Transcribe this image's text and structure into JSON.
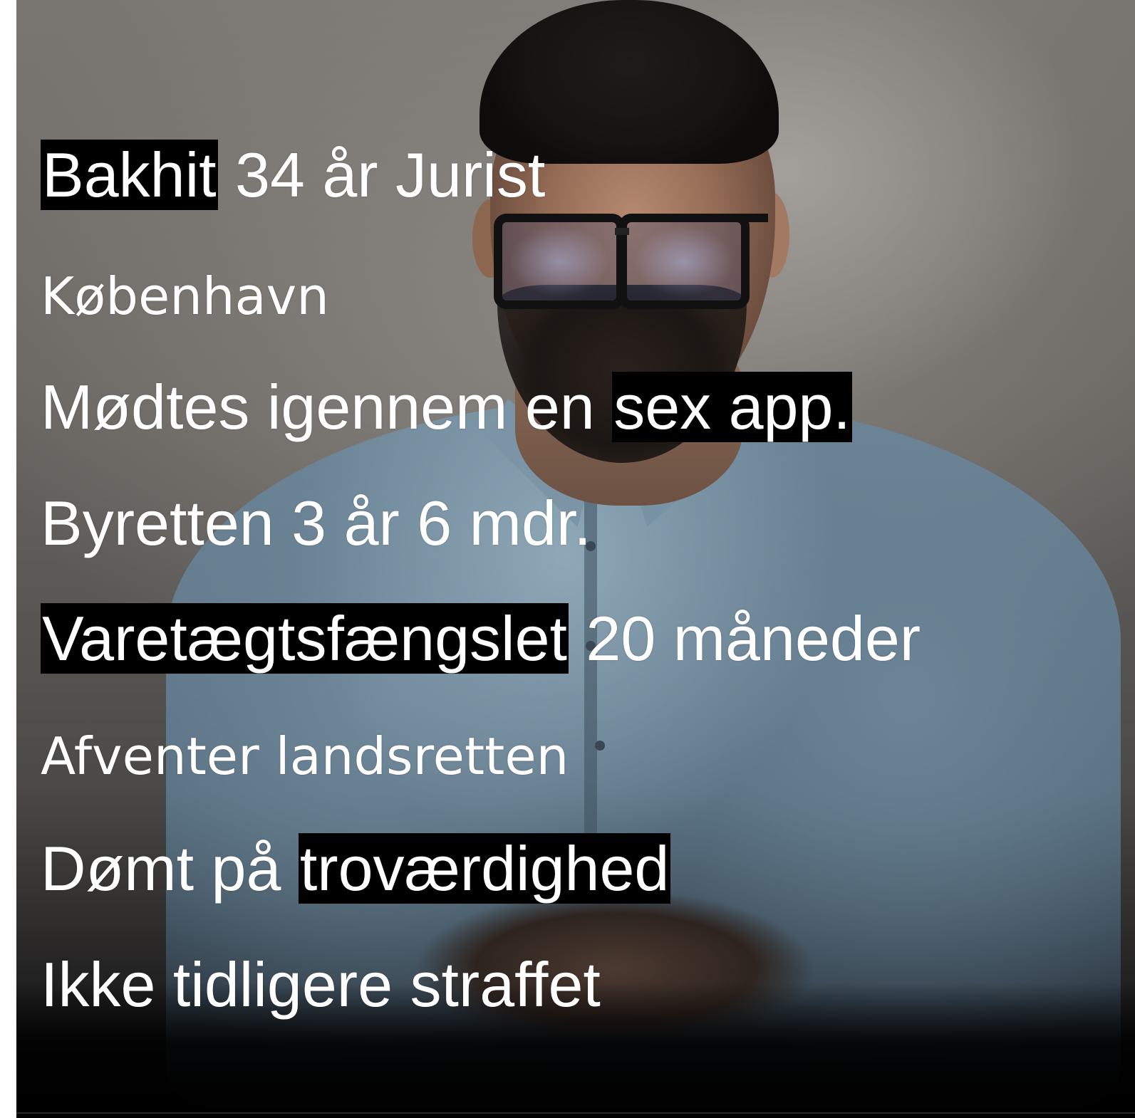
{
  "lines": [
    {
      "highlight": "Bakhit",
      "text": " 34 år Jurist"
    },
    {
      "text": "København"
    },
    {
      "text": "Mødtes igennem en ",
      "highlight": "sex app."
    },
    {
      "text": "Byretten 3 år 6 mdr."
    },
    {
      "highlight": "Varetægtsfængslet",
      "text": " 20 måneder"
    },
    {
      "text": "Afventer landsretten"
    },
    {
      "text": "Dømt på ",
      "highlight": "troværdighed"
    },
    {
      "text": "Ikke tidligere straffet"
    }
  ],
  "colors": {
    "text": "#ffffff",
    "highlight_background": "#000000",
    "shirt": "#6d8697",
    "background": "#7a7672"
  }
}
